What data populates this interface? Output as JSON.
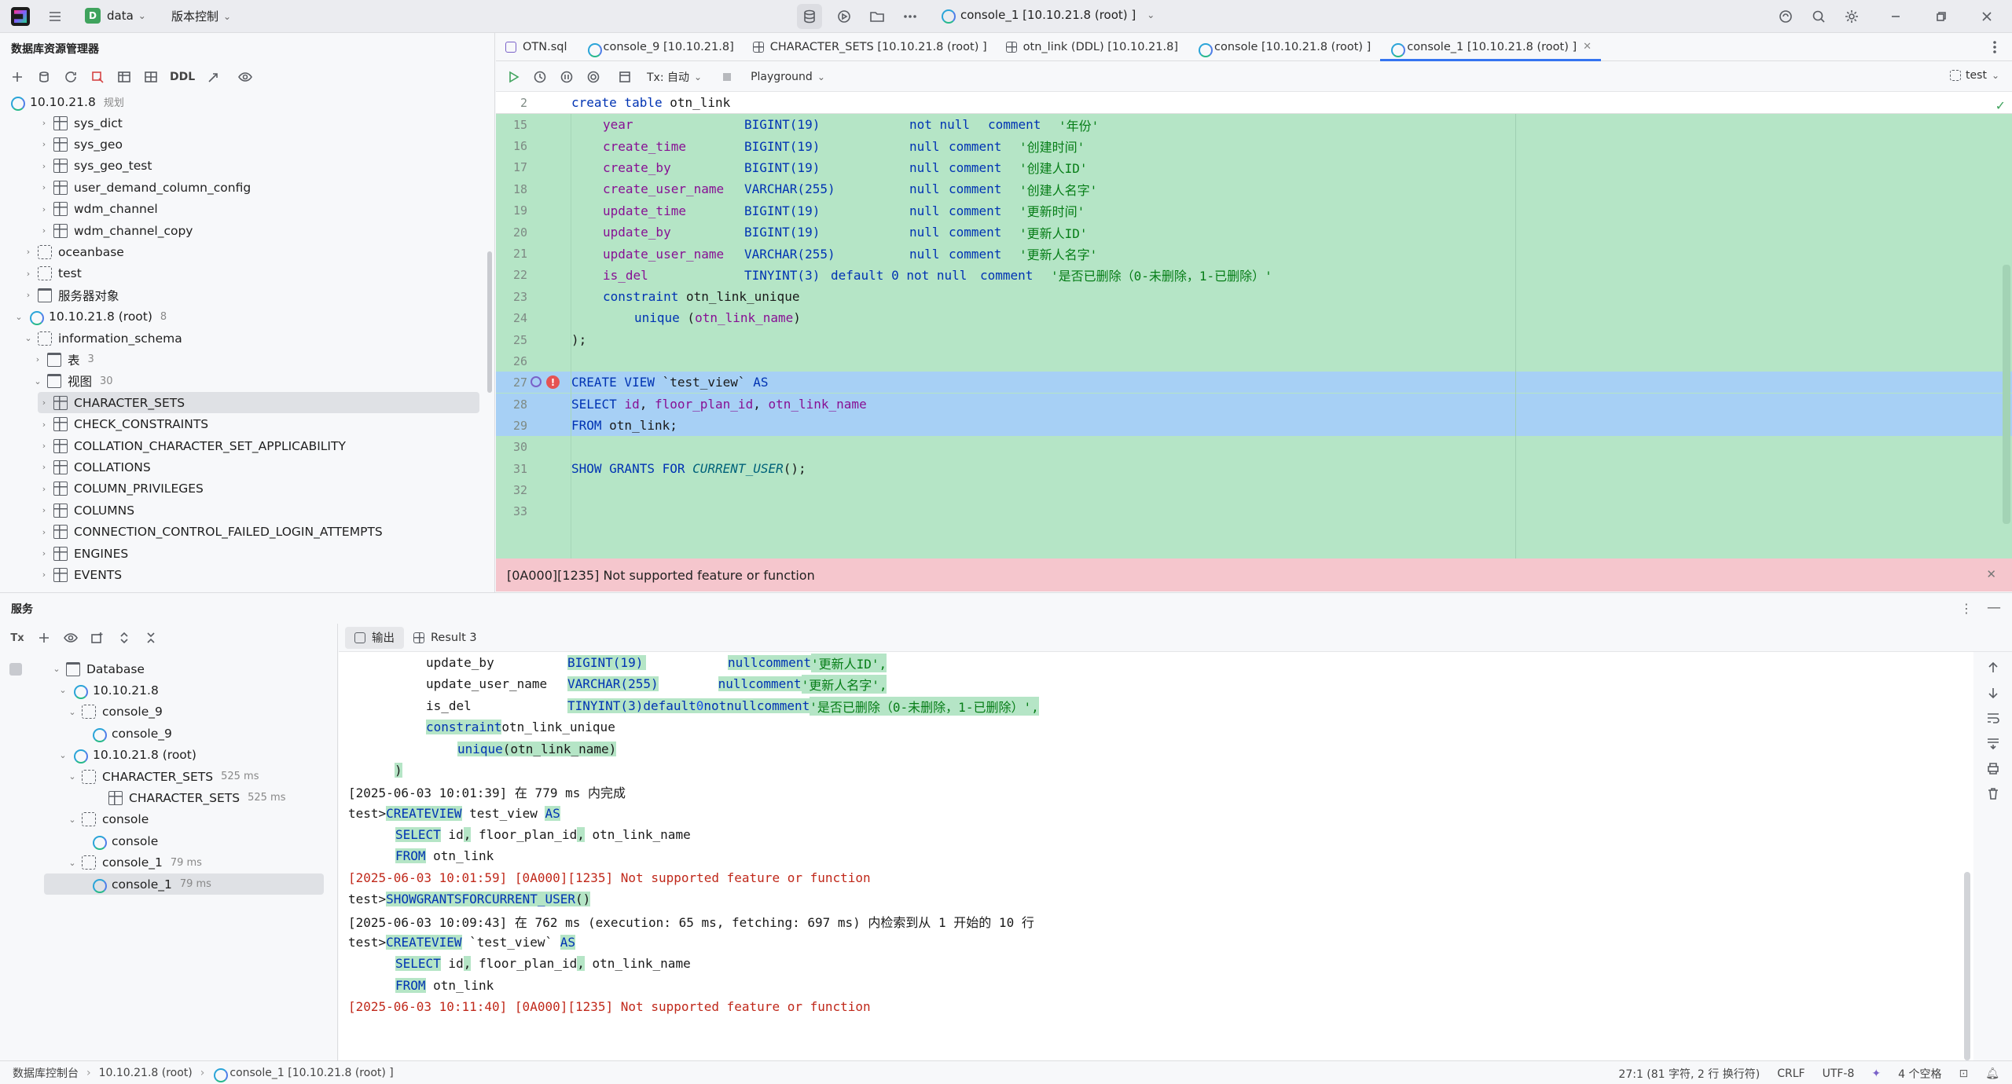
{
  "titlebar": {
    "project_badge": "D",
    "project_name": "data",
    "vcs_label": "版本控制",
    "run_config": "console_1 [10.10.21.8 (root) ]"
  },
  "db_panel": {
    "title": "数据库资源管理器",
    "toolbar_ddl": "DDL",
    "root_host": "10.10.21.8",
    "root_host_hint": "规划",
    "items": [
      {
        "label": "sys_dict",
        "kind": "table"
      },
      {
        "label": "sys_geo",
        "kind": "table"
      },
      {
        "label": "sys_geo_test",
        "kind": "table"
      },
      {
        "label": "user_demand_column_config",
        "kind": "table"
      },
      {
        "label": "wdm_channel",
        "kind": "table"
      },
      {
        "label": "wdm_channel_copy",
        "kind": "table"
      },
      {
        "label": "oceanbase",
        "kind": "schema"
      },
      {
        "label": "test",
        "kind": "schema"
      },
      {
        "label": "服务器对象",
        "kind": "folder"
      },
      {
        "label": "10.10.21.8 (root)",
        "kind": "host",
        "count": "8"
      },
      {
        "label": "information_schema",
        "kind": "schema"
      },
      {
        "label": "表",
        "kind": "folder",
        "count": "3"
      },
      {
        "label": "视图",
        "kind": "folder",
        "count": "30"
      },
      {
        "label": "CHARACTER_SETS",
        "kind": "table"
      },
      {
        "label": "CHECK_CONSTRAINTS",
        "kind": "table"
      },
      {
        "label": "COLLATION_CHARACTER_SET_APPLICABILITY",
        "kind": "table"
      },
      {
        "label": "COLLATIONS",
        "kind": "table"
      },
      {
        "label": "COLUMN_PRIVILEGES",
        "kind": "table"
      },
      {
        "label": "COLUMNS",
        "kind": "table"
      },
      {
        "label": "CONNECTION_CONTROL_FAILED_LOGIN_ATTEMPTS",
        "kind": "table"
      },
      {
        "label": "ENGINES",
        "kind": "table"
      },
      {
        "label": "EVENTS",
        "kind": "table"
      }
    ]
  },
  "tabs": [
    {
      "label": "OTN.sql"
    },
    {
      "label": "console_9 [10.10.21.8]"
    },
    {
      "label": "CHARACTER_SETS [10.10.21.8 (root) ]"
    },
    {
      "label": "otn_link (DDL) [10.10.21.8]"
    },
    {
      "label": "console [10.10.21.8 (root) ]"
    },
    {
      "label": "console_1 [10.10.21.8 (root) ]"
    }
  ],
  "editor_toolbar": {
    "tx_label": "Tx: 自动",
    "playground_label": "Playground",
    "schema_label": "test"
  },
  "editor": {
    "sticky_line_no": "2",
    "sticky_code": "create table otn_link",
    "lines": [
      {
        "no": "15",
        "col": "year",
        "type": "BIGINT(19)",
        "pre": "not null",
        "comment": "'年份'"
      },
      {
        "no": "16",
        "col": "create_time",
        "type": "BIGINT(19)",
        "pre": "null",
        "comment": "'创建时间'"
      },
      {
        "no": "17",
        "col": "create_by",
        "type": "BIGINT(19)",
        "pre": "null",
        "comment": "'创建人ID'"
      },
      {
        "no": "18",
        "col": "create_user_name",
        "type": "VARCHAR(255)",
        "pre": "null",
        "comment": "'创建人名字'"
      },
      {
        "no": "19",
        "col": "update_time",
        "type": "BIGINT(19)",
        "pre": "null",
        "comment": "'更新时间'"
      },
      {
        "no": "20",
        "col": "update_by",
        "type": "BIGINT(19)",
        "pre": "null",
        "comment": "'更新人ID'"
      },
      {
        "no": "21",
        "col": "update_user_name",
        "type": "VARCHAR(255)",
        "pre": "null",
        "comment": "'更新人名字'"
      },
      {
        "no": "22",
        "col": "is_del",
        "type": "TINYINT(3)",
        "pre": "default 0 not null",
        "comment": "'是否已删除（0-未删除，1-已删除）'"
      }
    ],
    "ln23": "23",
    "code23": "constraint otn_link_unique",
    "ln24": "24",
    "code24": "unique (otn_link_name)",
    "ln25": "25",
    "code25": ");",
    "ln26": "26",
    "ln27": "27",
    "code27": "CREATE VIEW `test_view` AS",
    "ln28": "28",
    "code28": "SELECT id, floor_plan_id, otn_link_name",
    "ln29": "29",
    "code29": "FROM otn_link;",
    "ln30": "30",
    "ln31": "31",
    "code31": "SHOW GRANTS FOR CURRENT_USER();",
    "ln32": "32",
    "ln33": "33",
    "error_message": "[0A000][1235] Not supported feature or function"
  },
  "services": {
    "title": "服务",
    "tx_label": "Tx",
    "tree": [
      {
        "label": "Database",
        "kind": "folder"
      },
      {
        "label": "10.10.21.8",
        "kind": "host"
      },
      {
        "label": "console_9",
        "kind": "session"
      },
      {
        "label": "console_9",
        "kind": "console"
      },
      {
        "label": "10.10.21.8 (root)",
        "kind": "host"
      },
      {
        "label": "CHARACTER_SETS",
        "kind": "session",
        "time": "525 ms"
      },
      {
        "label": "CHARACTER_SETS",
        "kind": "table",
        "time": "525 ms"
      },
      {
        "label": "console",
        "kind": "session"
      },
      {
        "label": "console",
        "kind": "console"
      },
      {
        "label": "console_1",
        "kind": "session",
        "time": "79 ms"
      },
      {
        "label": "console_1",
        "kind": "console",
        "time": "79 ms"
      }
    ],
    "out_tab_output": "输出",
    "out_tab_result": "Result 3",
    "output": {
      "l1_col": "update_by",
      "l1_type": "BIGINT(19)",
      "l1_comment": "'更新人ID',",
      "l2_col": "update_user_name",
      "l2_type": "VARCHAR(255)",
      "l2_comment": "'更新人名字',",
      "l3_col": "is_del",
      "l3_type": "TINYINT(3)",
      "l3_comment": "'是否已删除（0-未删除，1-已删除）',",
      "l4": "constraint",
      "l4b": "otn_link_unique",
      "l5": "unique",
      "l5b": "(otn_link_name)",
      "l6": ")",
      "l7": "[2025-06-03 10:01:39] 在 779 ms 内完成",
      "prompt": "test>",
      "l8": "CREATE VIEW test_view AS",
      "l9": "SELECT id, floor_plan_id, otn_link_name",
      "l10": "FROM otn_link",
      "l11": "[2025-06-03 10:01:59] [0A000][1235] Not supported feature or function",
      "l12": "SHOW GRANTS FOR CURRENT_USER()",
      "l13": "[2025-06-03 10:09:43] 在 762 ms (execution: 65 ms, fetching: 697 ms) 内检索到从 1 开始的 10 行",
      "l14": "CREATE VIEW `test_view` AS",
      "l15": "SELECT id, floor_plan_id, otn_link_name",
      "l16": "FROM otn_link",
      "l17": "[2025-06-03 10:11:40] [0A000][1235] Not supported feature or function"
    }
  },
  "statusbar": {
    "crumb1": "数据库控制台",
    "crumb2": "10.10.21.8 (root)",
    "crumb3": "console_1 [10.10.21.8 (root) ]",
    "position": "27:1 (81 字符, 2 行 换行符)",
    "line_ending": "CRLF",
    "encoding": "UTF-8",
    "indent": "4 个空格"
  }
}
